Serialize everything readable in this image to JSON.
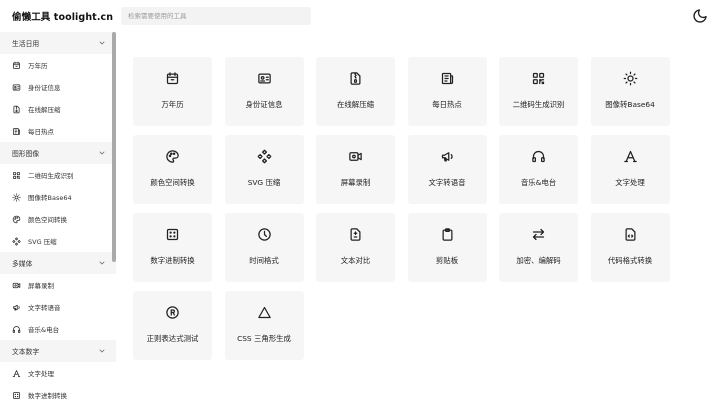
{
  "header": {
    "title": "偷懒工具 toolight.cn",
    "search_placeholder": "检索需要使用的工具",
    "theme_icon": "moon-icon"
  },
  "sidebar": {
    "groups": [
      {
        "label": "生活日用",
        "items": [
          {
            "label": "万年历",
            "icon": "calendar-icon"
          },
          {
            "label": "身份证信息",
            "icon": "id-card-icon"
          },
          {
            "label": "在线解压缩",
            "icon": "archive-icon"
          },
          {
            "label": "每日热点",
            "icon": "news-icon"
          }
        ]
      },
      {
        "label": "图形图像",
        "items": [
          {
            "label": "二维码生成识别",
            "icon": "qrcode-icon"
          },
          {
            "label": "图像转Base64",
            "icon": "sun-icon"
          },
          {
            "label": "颜色空间转换",
            "icon": "palette-icon"
          },
          {
            "label": "SVG 压缩",
            "icon": "svg-icon"
          }
        ]
      },
      {
        "label": "多媒体",
        "items": [
          {
            "label": "屏幕录制",
            "icon": "video-icon"
          },
          {
            "label": "文字转语音",
            "icon": "megaphone-icon"
          },
          {
            "label": "音乐&电台",
            "icon": "headphones-icon"
          }
        ]
      },
      {
        "label": "文本数字",
        "items": [
          {
            "label": "文字处理",
            "icon": "text-icon"
          },
          {
            "label": "数字进制转换",
            "icon": "dice-icon"
          }
        ]
      }
    ]
  },
  "tools": [
    {
      "label": "万年历",
      "icon": "calendar-icon"
    },
    {
      "label": "身份证信息",
      "icon": "id-card-icon"
    },
    {
      "label": "在线解压缩",
      "icon": "archive-icon"
    },
    {
      "label": "每日热点",
      "icon": "news-icon"
    },
    {
      "label": "二维码生成识别",
      "icon": "qrcode-icon"
    },
    {
      "label": "图像转Base64",
      "icon": "sun-icon"
    },
    {
      "label": "颜色空间转换",
      "icon": "palette-icon"
    },
    {
      "label": "SVG 压缩",
      "icon": "svg-icon"
    },
    {
      "label": "屏幕录制",
      "icon": "video-icon"
    },
    {
      "label": "文字转语音",
      "icon": "megaphone-icon"
    },
    {
      "label": "音乐&电台",
      "icon": "headphones-icon"
    },
    {
      "label": "文字处理",
      "icon": "text-icon"
    },
    {
      "label": "数字进制转换",
      "icon": "dice-icon"
    },
    {
      "label": "时间格式",
      "icon": "clock-icon"
    },
    {
      "label": "文本对比",
      "icon": "diff-icon"
    },
    {
      "label": "剪贴板",
      "icon": "clipboard-icon"
    },
    {
      "label": "加密、编解码",
      "icon": "arrows-icon"
    },
    {
      "label": "代码格式转换",
      "icon": "code-file-icon"
    },
    {
      "label": "正则表达式测试",
      "icon": "regex-icon"
    },
    {
      "label": "CSS 三角形生成",
      "icon": "triangle-icon"
    }
  ]
}
